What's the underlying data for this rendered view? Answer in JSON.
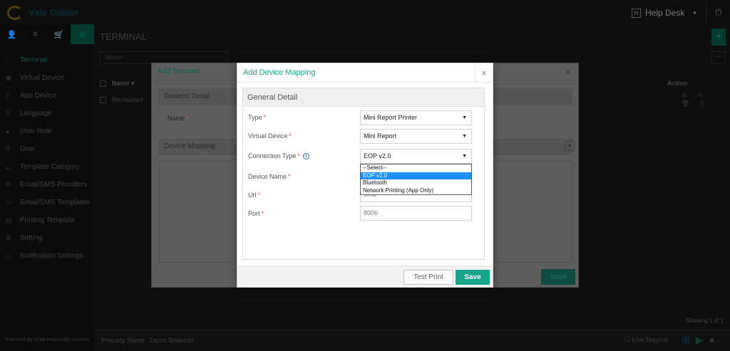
{
  "app": {
    "logo_text": "Vale Online",
    "helpdesk_key": "H",
    "helpdesk_label": "Help Desk",
    "helpdesk_caret": "▾",
    "power_icon": "power-icon"
  },
  "sidebar": {
    "tabs": [
      "👤",
      "≡",
      "🛒",
      "⚙"
    ],
    "items": [
      {
        "icon": "▫",
        "label": "Terminal"
      },
      {
        "icon": "▣",
        "label": "Virtual Device"
      },
      {
        "icon": "▯",
        "label": "App Device"
      },
      {
        "icon": "⎘",
        "label": "Language"
      },
      {
        "icon": "●",
        "label": "User Role"
      },
      {
        "icon": "⚲",
        "label": "User"
      },
      {
        "icon": "◒",
        "label": "Template Category"
      },
      {
        "icon": "✉",
        "label": "Email/SMS Providers"
      },
      {
        "icon": "▭",
        "label": "Email/SMS Templates"
      },
      {
        "icon": "▤",
        "label": "Printing Template"
      },
      {
        "icon": "⚙",
        "label": "Setting"
      },
      {
        "icon": "△",
        "label": "Notification Settings"
      }
    ],
    "powered_by": "Powered By eZee Hospitality Solution"
  },
  "main": {
    "title": "TERMINAL",
    "add_symbol": "+",
    "search_placeholder": "Search",
    "more_symbol": "···",
    "table": {
      "header_name": "Name ▾",
      "header_action": "Action",
      "row_name": "Restaurant",
      "row_actions": "⚙ ✎ 🗑 ⎘"
    },
    "showing": "Showing 1 of 1",
    "property_name": "Property Name : Demo Bhavesh",
    "live_support": "☐ Live Support"
  },
  "add_terminal_modal": {
    "title": "Add Terminal",
    "close": "×",
    "section_general": "General Detail",
    "name_label": "Name",
    "section_device_mapping": "Device Mapping",
    "plus": "+",
    "save": "Save"
  },
  "device_mapping_modal": {
    "title": "Add Device Mapping",
    "close": "×",
    "section_title": "General Detail",
    "required_mark": "*",
    "fields": {
      "type": {
        "label": "Type",
        "value": "Mini Report Printer"
      },
      "virtual_device": {
        "label": "Virtual Device",
        "value": "Mini Report"
      },
      "connection_type": {
        "label": "Connection Type",
        "value": "EOP v2.0"
      },
      "device_name": {
        "label": "Device Name"
      },
      "url": {
        "label": "Url",
        "placeholder": "URL"
      },
      "port": {
        "label": "Port",
        "value": "8006"
      }
    },
    "connection_options": [
      "--Select--",
      "EOP v2.0",
      "Bluetooth",
      "Network Printing (App Only)"
    ],
    "selected_option": "EOP v2.0",
    "buttons": {
      "test_print": "Test Print",
      "save": "Save"
    }
  },
  "colors": {
    "accent": "#16a58a",
    "required": "#d9534f",
    "dropdown_highlight": "#1e90ff"
  }
}
